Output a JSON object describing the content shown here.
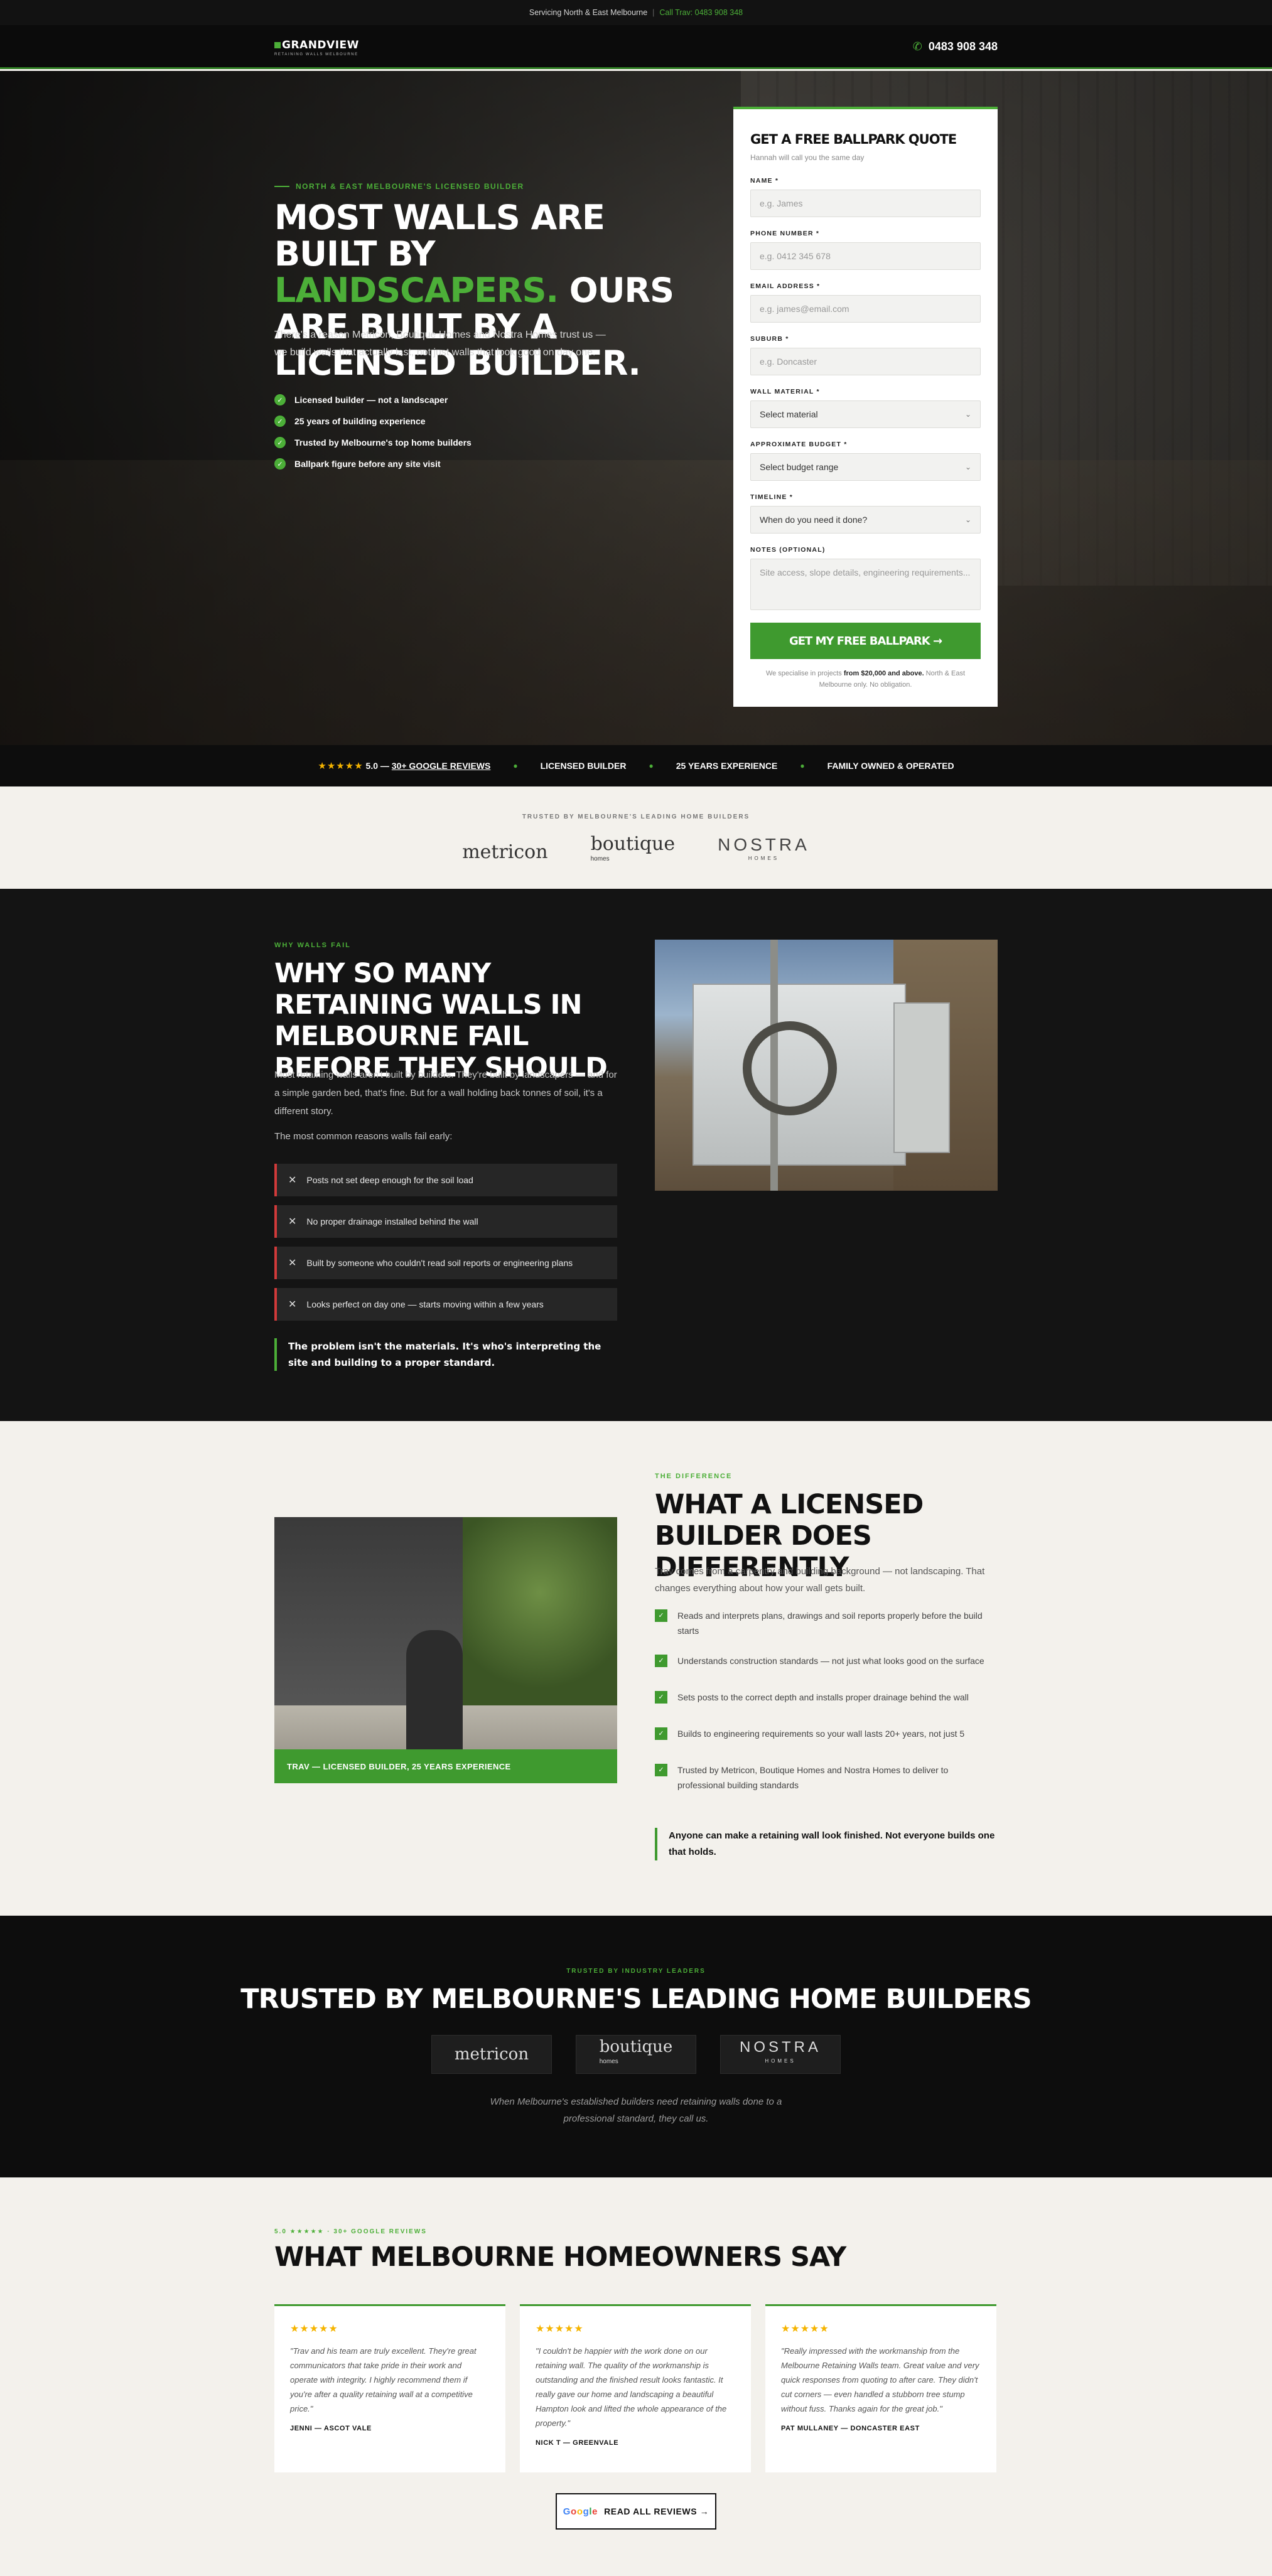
{
  "topbar": {
    "service": "Servicing North & East Melbourne",
    "sep": "|",
    "call": "Call Trav: 0483 908 348"
  },
  "header": {
    "logo_name": "GRANDVIEW",
    "logo_sub": "RETAINING WALLS MELBOURNE",
    "phone": "0483 908 348",
    "phone_icon": "phone-icon"
  },
  "hero": {
    "eyebrow": "NORTH & EAST MELBOURNE'S LICENSED BUILDER",
    "h1_a": "MOST WALLS ARE BUILT BY",
    "h1_b": "LANDSCAPERS.",
    "h1_c": " OURS ARE BUILT BY A LICENSED BUILDER.",
    "intro": "There's a reason Metricon, Boutique Homes and Nostra Homes trust us — we build walls that actually last, not just walls that look good on day one.",
    "checks": [
      "Licensed builder — not a landscaper",
      "25 years of building experience",
      "Trusted by Melbourne's top home builders",
      "Ballpark figure before any site visit"
    ]
  },
  "form": {
    "title": "GET A FREE BALLPARK QUOTE",
    "subtitle": "Hannah will call you the same day",
    "name_label": "NAME *",
    "name_ph": "e.g. James",
    "phone_label": "PHONE NUMBER *",
    "phone_ph": "e.g. 0412 345 678",
    "email_label": "EMAIL ADDRESS *",
    "email_ph": "e.g. james@email.com",
    "suburb_label": "SUBURB *",
    "suburb_ph": "e.g. Doncaster",
    "material_label": "WALL MATERIAL *",
    "material_val": "Select material",
    "budget_label": "APPROXIMATE BUDGET *",
    "budget_val": "Select budget range",
    "timeline_label": "TIMELINE *",
    "timeline_val": "When do you need it done?",
    "notes_label": "NOTES (OPTIONAL)",
    "notes_ph": "Site access, slope details, engineering requirements...",
    "submit": "GET MY FREE BALLPARK →",
    "note_a": "We specialise in projects ",
    "note_b": "from $20,000 and above.",
    "note_c": " North & East Melbourne only. No obligation."
  },
  "strip": {
    "stars": "★★★★★",
    "rating": "5.0 — ",
    "reviews": "30+ GOOGLE REVIEWS",
    "item1": "LICENSED BUILDER",
    "item2": "25 YEARS EXPERIENCE",
    "item3": "FAMILY OWNED & OPERATED",
    "dot": "●"
  },
  "trustband": {
    "label": "TRUSTED BY MELBOURNE'S LEADING HOME BUILDERS",
    "logo1": "metricon",
    "logo2": "boutique",
    "logo2_sub": "homes",
    "logo3": "NOSTRA",
    "logo3_sub": "HOMES"
  },
  "why": {
    "eyebrow": "WHY WALLS FAIL",
    "title": "WHY SO MANY RETAINING WALLS IN MELBOURNE FAIL BEFORE THEY SHOULD",
    "p1": "Most retaining walls aren't built by builders. They're built by landscapers — and for a simple garden bed, that's fine. But for a wall holding back tonnes of soil, it's a different story.",
    "p2": "The most common reasons walls fail early:",
    "fails": [
      "Posts not set deep enough for the soil load",
      "No proper drainage installed behind the wall",
      "Built by someone who couldn't read soil reports or engineering plans",
      "Looks perfect on day one — starts moving within a few years"
    ],
    "callout": "The problem isn't the materials. It's who's interpreting the site and building to a proper standard."
  },
  "diff": {
    "eyebrow": "THE DIFFERENCE",
    "title": "WHAT A LICENSED BUILDER DOES DIFFERENTLY",
    "p1": "Trav comes from a carpentry and building background — not landscaping. That changes everything about how your wall gets built.",
    "items": [
      "Reads and interprets plans, drawings and soil reports properly before the build starts",
      "Understands construction standards — not just what looks good on the surface",
      "Sets posts to the correct depth and installs proper drainage behind the wall",
      "Builds to engineering requirements so your wall lasts 20+ years, not just 5",
      "Trusted by Metricon, Boutique Homes and Nostra Homes to deliver to professional building standards"
    ],
    "caption": "TRAV — LICENSED BUILDER, 25 YEARS EXPERIENCE",
    "callout": "Anyone can make a retaining wall look finished. Not everyone builds one that holds."
  },
  "trusted": {
    "eyebrow": "TRUSTED BY INDUSTRY LEADERS",
    "title": "TRUSTED BY MELBOURNE'S LEADING HOME BUILDERS",
    "quote1": "When Melbourne's established builders need retaining walls done to a",
    "quote2": "professional standard, they call us."
  },
  "reviews": {
    "eyebrow": "5.0 ★★★★★ · 30+ GOOGLE REVIEWS",
    "title": "WHAT MELBOURNE HOMEOWNERS SAY",
    "cards": [
      {
        "stars": "★★★★★",
        "text": "\"Trav and his team are truly excellent. They're great communicators that take pride in their work and operate with integrity. I highly recommend them if you're after a quality retaining wall at a competitive price.\"",
        "author": "JENNI — ASCOT VALE"
      },
      {
        "stars": "★★★★★",
        "text": "\"I couldn't be happier with the work done on our retaining wall. The quality of the workmanship is outstanding and the finished result looks fantastic. It really gave our home and landscaping a beautiful Hampton look and lifted the whole appearance of the property.\"",
        "author": "NICK T — GREENVALE"
      },
      {
        "stars": "★★★★★",
        "text": "\"Really impressed with the workmanship from the Melbourne Retaining Walls team. Great value and very quick responses from quoting to after care. They didn't cut corners — even handled a stubborn tree stump without fuss. Thanks again for the great job.\"",
        "author": "PAT MULLANEY — DONCASTER EAST"
      }
    ],
    "button": "READ ALL REVIEWS →",
    "google": [
      "G",
      "o",
      "o",
      "g",
      "l",
      "e"
    ]
  },
  "colors": {
    "accent": "#4caf38",
    "dark": "#0d0d0d",
    "cream": "#f3f1ec",
    "fail": "#d23a3a",
    "star": "#f5b400"
  }
}
